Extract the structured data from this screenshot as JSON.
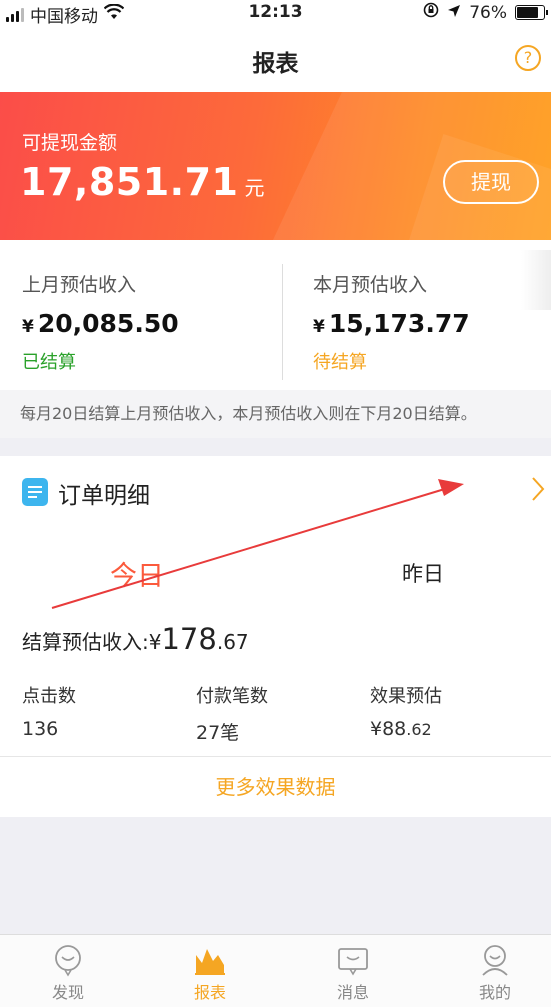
{
  "status_bar": {
    "carrier": "中国移动",
    "time": "12:13",
    "battery": "76%"
  },
  "nav": {
    "title": "报表",
    "help_icon": "question-circle-icon"
  },
  "banner": {
    "label": "可提现金额",
    "amount": "17,851.71",
    "unit": "元",
    "withdraw_label": "提现"
  },
  "earnings": {
    "last_month": {
      "label": "上月预估收入",
      "currency": "¥",
      "value": "20,085.50",
      "status": "已结算",
      "status_color": "#2aa12a"
    },
    "this_month": {
      "label": "本月预估收入",
      "currency": "¥",
      "value": "15,173.77",
      "status": "待结算",
      "status_color": "#f5a623"
    },
    "note": "每月20日结算上月预估收入，本月预估收入则在下月20日结算。"
  },
  "orders": {
    "title": "订单明细",
    "tabs": {
      "today": "今日",
      "yesterday": "昨日"
    },
    "settle_label": "结算预估收入:",
    "settle_currency": "¥",
    "settle_int": "178",
    "settle_dec": ".67",
    "stats": [
      {
        "label": "点击数",
        "value": "136"
      },
      {
        "label": "付款笔数",
        "value": "27笔"
      },
      {
        "label": "效果预估",
        "value_int": "¥88",
        "value_dec": ".62"
      }
    ],
    "more": "更多效果数据"
  },
  "tabbar": {
    "items": [
      {
        "label": "发现",
        "icon": "discover-icon"
      },
      {
        "label": "报表",
        "icon": "report-chart-icon"
      },
      {
        "label": "消息",
        "icon": "message-icon"
      },
      {
        "label": "我的",
        "icon": "profile-icon"
      }
    ],
    "active_color": "#f5a623"
  },
  "colors": {
    "accent": "#f5a623",
    "banner_start": "#fb4d49",
    "banner_end": "#ff9b15",
    "today_tab": "#fb5a3c",
    "annotation_arrow": "#e83b3b"
  }
}
